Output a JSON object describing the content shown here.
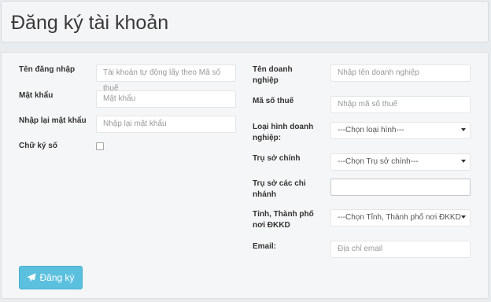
{
  "header": {
    "title": "Đăng ký tài khoản"
  },
  "left": {
    "username_label": "Tên đăng nhập",
    "username_placeholder": "Tài khoản tự động lấy theo Mã số thuế",
    "password_label": "Mật khẩu",
    "password_placeholder": "Mật khẩu",
    "confirm_label": "Nhập lại mật khẩu",
    "confirm_placeholder": "Nhập lại mật khẩu",
    "signature_label": "Chữ ký số"
  },
  "right": {
    "company_label_1": "Tên doanh",
    "company_label_2": "nghiệp",
    "company_placeholder": "Nhập tên doanh nghiệp",
    "tax_label": "Mã số thuế",
    "tax_placeholder": "Nhập mã số thuế",
    "type_label_1": "Loại hình doanh",
    "type_label_2": "nghiệp:",
    "type_value": "---Chọn loại hình---",
    "hq_label": "Trụ sở chính",
    "hq_value": "---Chọn Trụ sở chính---",
    "branch_label_1": "Trụ sở các chi",
    "branch_label_2": "nhánh",
    "branch_value": "",
    "province_label_1": "Tỉnh, Thành phố",
    "province_label_2": "nơi ĐKKD",
    "province_value": "---Chọn Tỉnh, Thành phố nơi ĐKKD",
    "email_label": "Email:",
    "email_placeholder": "Địa chỉ email"
  },
  "actions": {
    "register_label": "Đăng ký"
  },
  "colors": {
    "button": "#5bc0de",
    "panel": "#f5f6f7"
  },
  "icons": {
    "register": "paper-plane-icon",
    "dropdown": "caret-down-icon"
  }
}
